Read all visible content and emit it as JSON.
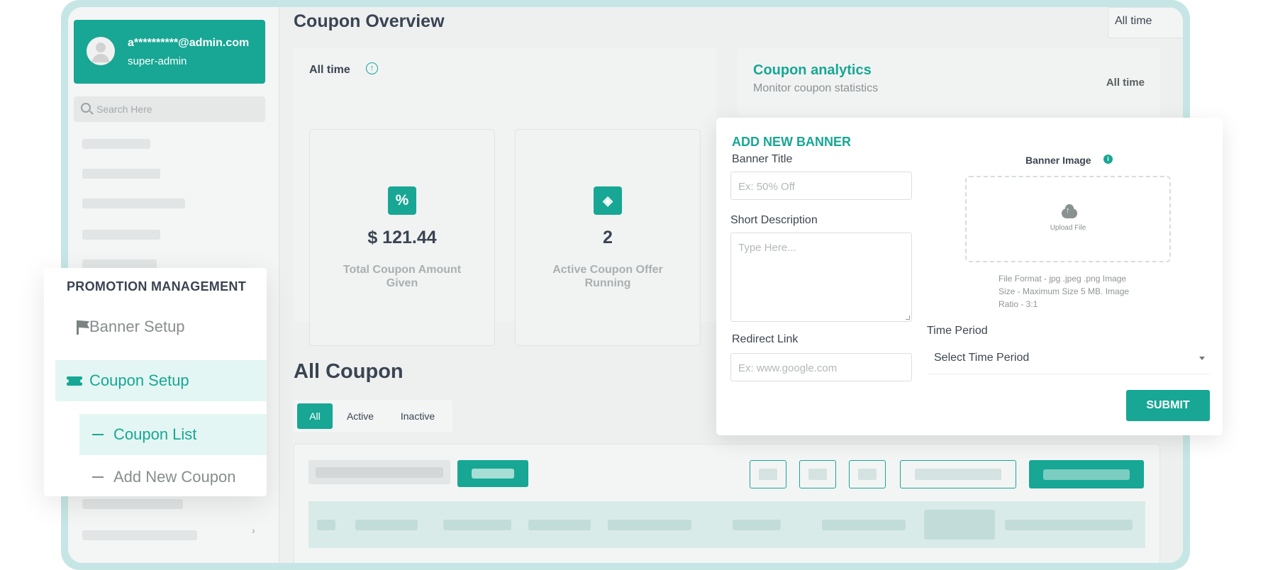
{
  "user": {
    "email": "a**********@admin.com",
    "role": "super-admin"
  },
  "search": {
    "placeholder": "Search Here"
  },
  "page": {
    "title": "Coupon Overview",
    "period_filter": "All time"
  },
  "stats": {
    "label": "All time",
    "cards": [
      {
        "icon": "percent-icon",
        "glyph": "%",
        "value": "$ 121.44",
        "label": "Total Coupon Amount Given"
      },
      {
        "icon": "ticket-diamond-icon",
        "glyph": "◈",
        "value": "2",
        "label": "Active Coupon Offer Running"
      }
    ]
  },
  "analytics": {
    "title": "Coupon analytics",
    "subtitle": "Monitor coupon statistics",
    "period": "All time"
  },
  "coupons": {
    "title": "All Coupon",
    "tabs": [
      "All",
      "Active",
      "Inactive"
    ],
    "active_tab": "All"
  },
  "promotion": {
    "title": "PROMOTION MANAGEMENT",
    "items": [
      {
        "label": "Banner Setup",
        "icon": "flag-icon",
        "active": false
      },
      {
        "label": "Coupon Setup",
        "icon": "ticket-icon",
        "active": true
      }
    ],
    "subitems": [
      {
        "label": "Coupon List",
        "active": true
      },
      {
        "label": "Add New Coupon",
        "active": false
      }
    ]
  },
  "banner_form": {
    "heading": "ADD NEW BANNER",
    "title_label": "Banner Title",
    "title_placeholder": "Ex: 50% Off",
    "desc_label": "Short Description",
    "desc_placeholder": "Type Here...",
    "image_label": "Banner Image",
    "upload_text": "Upload File",
    "hint_lines": [
      "File Format - jpg .jpeg .png Image",
      "Size - Maximum Size 5 MB. Image",
      "Ratio - 3:1"
    ],
    "link_label": "Redirect Link",
    "link_placeholder": "Ex: www.google.com",
    "period_label": "Time Period",
    "period_placeholder": "Select Time Period",
    "submit_label": "SUBMIT"
  },
  "colors": {
    "accent": "#17a794",
    "accent_light": "#e4f6f3",
    "frame": "#c5e6e4",
    "text_dark": "#3a4452"
  }
}
